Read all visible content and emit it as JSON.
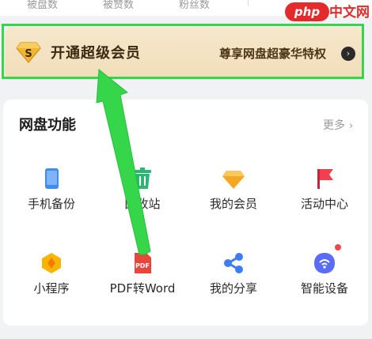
{
  "stats": {
    "items": [
      {
        "label": "被盘数"
      },
      {
        "label": "被赞数"
      },
      {
        "label": "粉丝数"
      }
    ]
  },
  "watermark": {
    "brand": "php",
    "suffix": "中文网"
  },
  "vip_banner": {
    "badge_letter": "S",
    "title": "开通超级会员",
    "subtitle": "尊享网盘超豪华特权",
    "arrow": "›"
  },
  "features": {
    "title": "网盘功能",
    "more_label": "更多",
    "more_chevron": "›",
    "items": [
      {
        "label": "手机备份",
        "icon": "phone-backup-icon",
        "color": "#3d8cf5"
      },
      {
        "label": "回收站",
        "icon": "recycle-bin-icon",
        "color": "#2bb673"
      },
      {
        "label": "我的会员",
        "icon": "diamond-icon",
        "color": "#f5a623"
      },
      {
        "label": "活动中心",
        "icon": "flag-icon",
        "color": "#f0404f"
      },
      {
        "label": "小程序",
        "icon": "hexagon-icon",
        "color": "#f7b500"
      },
      {
        "label": "PDF转Word",
        "icon": "pdf-icon",
        "color": "#e8453c",
        "icon_text": "PDF"
      },
      {
        "label": "我的分享",
        "icon": "share-icon",
        "color": "#3d7cf5"
      },
      {
        "label": "智能设备",
        "icon": "smart-device-icon",
        "color": "#5a6cf5",
        "badge": "dot"
      }
    ]
  },
  "annotation": {
    "color": "#35d64a"
  }
}
